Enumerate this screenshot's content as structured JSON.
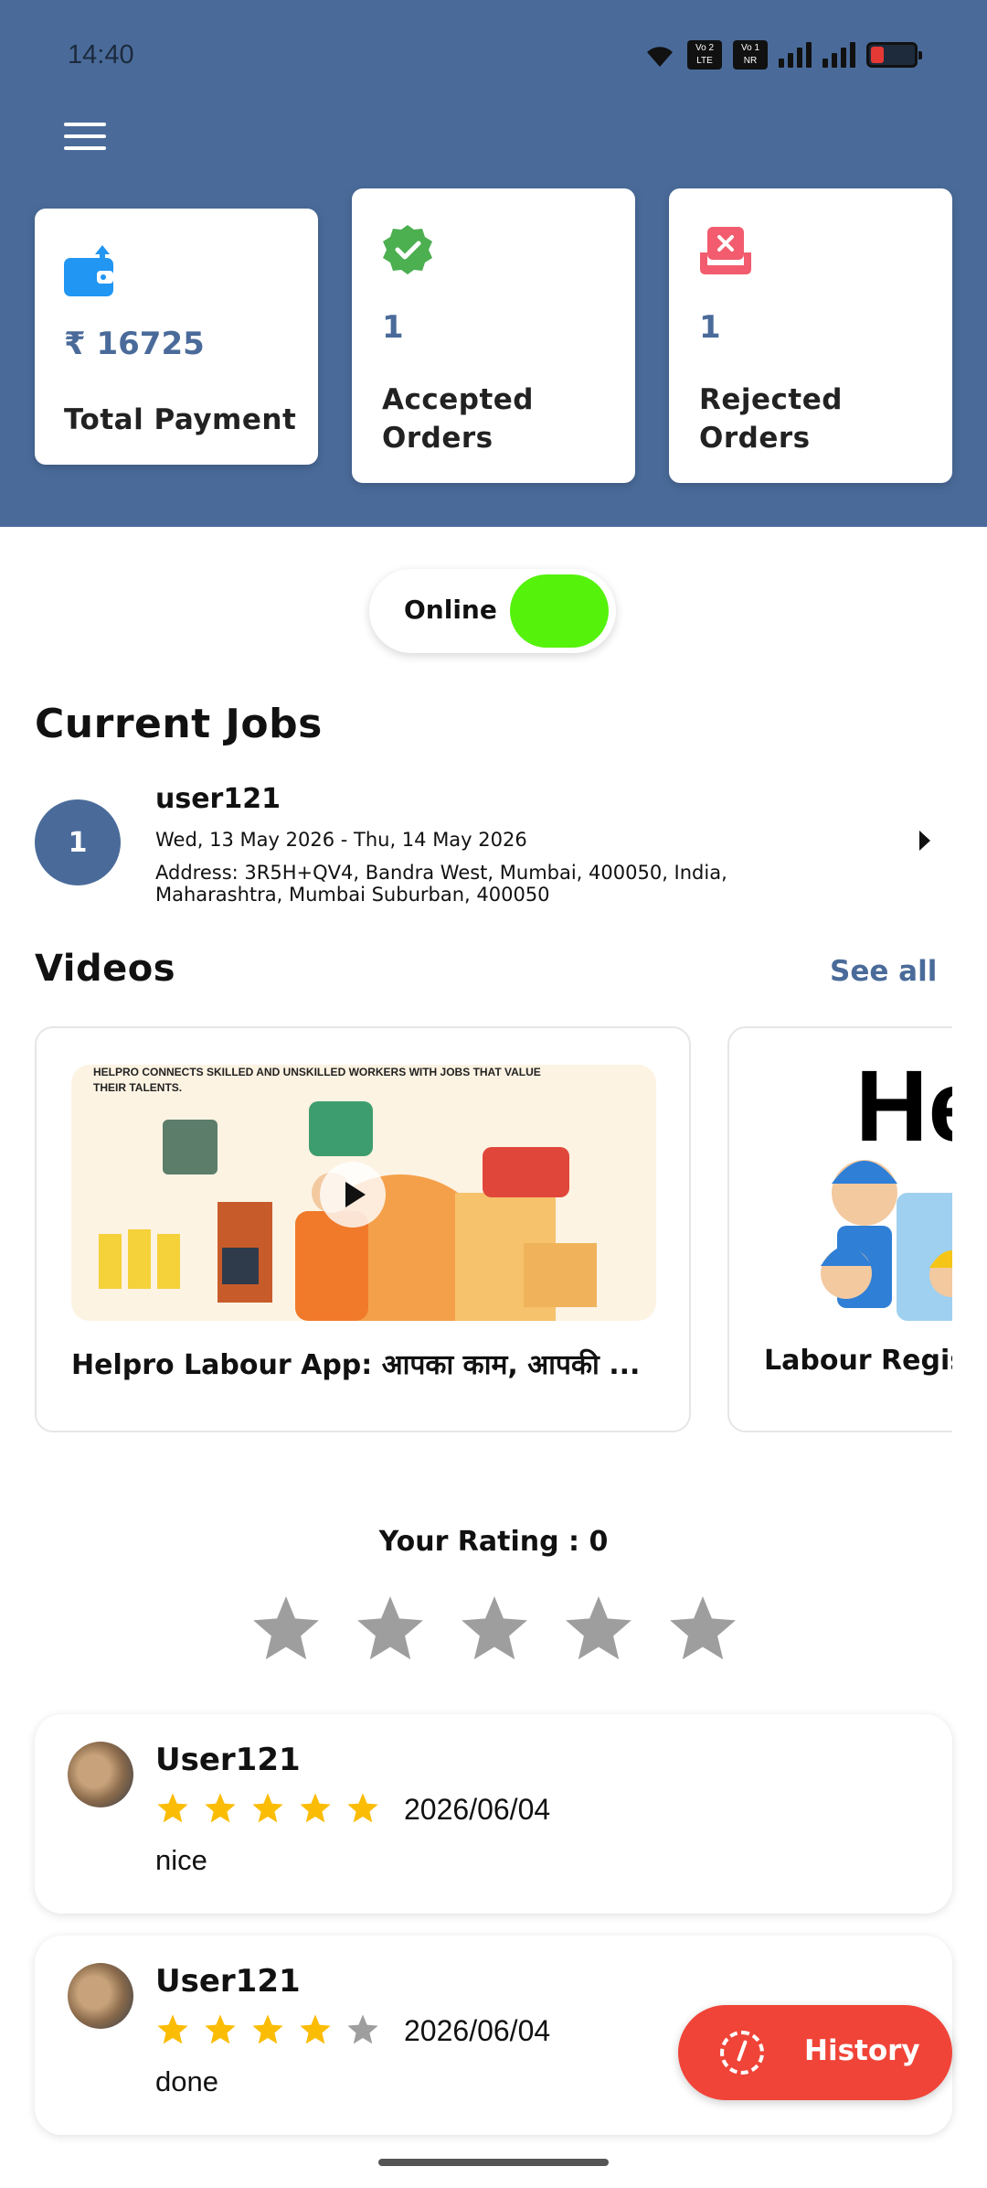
{
  "status_bar": {
    "time": "14:40",
    "sim1_tag": "Vo 2\nLTE",
    "sim2_tag": "Vo 1\nNR"
  },
  "header": {
    "menu_icon": "hamburger-menu-icon"
  },
  "stats": {
    "total_payment": {
      "icon": "wallet-upload-icon",
      "value": "₹ 16725",
      "label": "Total Payment",
      "icon_color": "#2196f3"
    },
    "accepted_orders": {
      "icon": "check-badge-icon",
      "value": "1",
      "label": "Accepted Orders",
      "icon_color": "#4caf50"
    },
    "rejected_orders": {
      "icon": "reject-box-icon",
      "value": "1",
      "label": "Rejected Orders",
      "icon_color": "#f25c6e"
    }
  },
  "online_toggle": {
    "label": "Online",
    "state": "on",
    "color": "#55f20c"
  },
  "current_jobs": {
    "title": "Current Jobs",
    "items": [
      {
        "index": "1",
        "name": "user121",
        "dates": "Wed,  13 May 2026 - Thu,  14 May 2026",
        "address": "Address: 3R5H+QV4, Bandra West, Mumbai, 400050, India, Maharashtra, Mumbai Suburban, 400050"
      }
    ]
  },
  "videos": {
    "title": "Videos",
    "see_all": "See all",
    "items": [
      {
        "thumb_caption": "HELPRO CONNECTS SKILLED AND UNSKILLED WORKERS WITH JOBS THAT VALUE THEIR TALENTS.",
        "title": "Helpro Labour App: आपका काम, आपकी ..."
      },
      {
        "thumb_caption": "He",
        "title": "Labour Regis"
      }
    ]
  },
  "rating": {
    "label": "Your Rating : 0",
    "value": 0,
    "max": 5
  },
  "reviews": [
    {
      "name": "User121",
      "stars": 5,
      "date": "2026/06/04",
      "text": "nice"
    },
    {
      "name": "User121",
      "stars": 4,
      "date": "2026/06/04",
      "text": "done"
    }
  ],
  "history_button": {
    "label": "History",
    "icon": "history-clock-icon"
  },
  "colors": {
    "primary": "#4a6b9a",
    "star_filled": "#fbbc05",
    "star_empty": "#9e9e9e",
    "history": "#f04438"
  }
}
